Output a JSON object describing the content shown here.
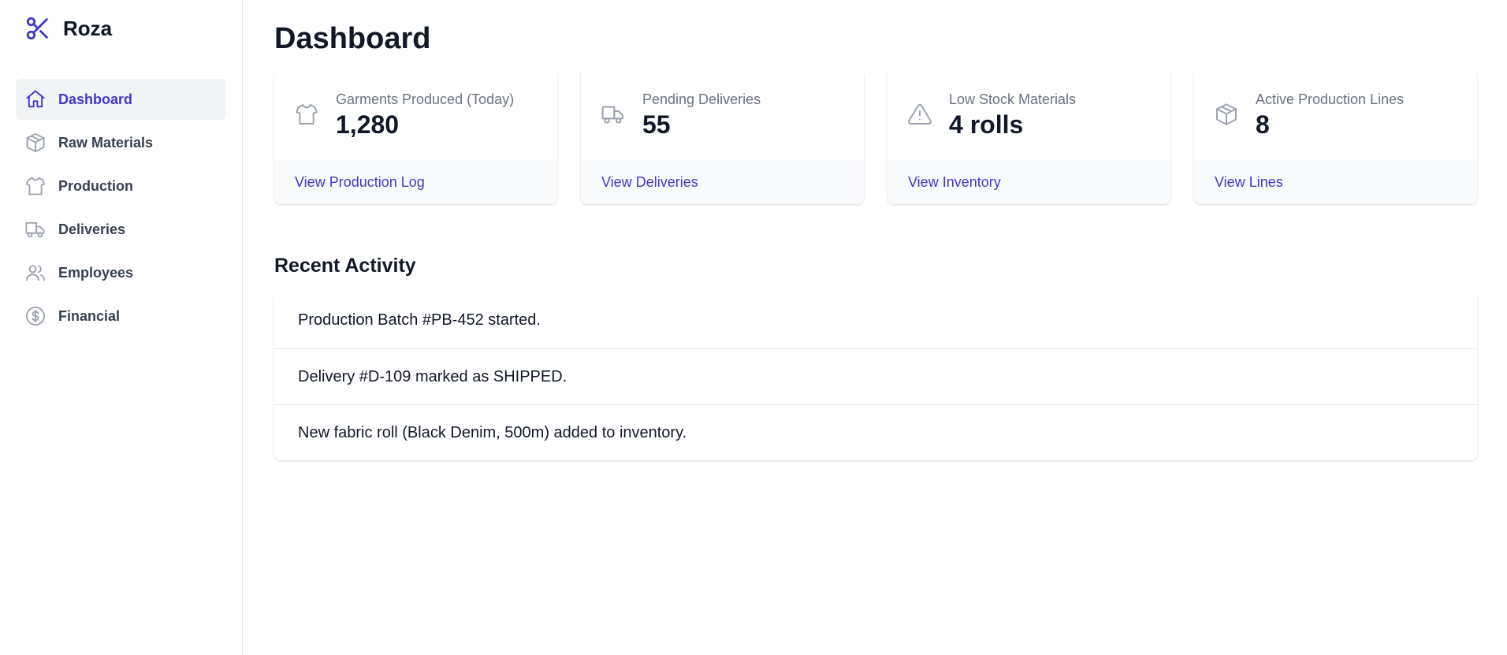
{
  "app": {
    "name": "Roza"
  },
  "sidebar": {
    "items": [
      {
        "label": "Dashboard",
        "icon": "home-icon",
        "active": true
      },
      {
        "label": "Raw Materials",
        "icon": "cube-icon"
      },
      {
        "label": "Production",
        "icon": "shirt-icon"
      },
      {
        "label": "Deliveries",
        "icon": "truck-icon"
      },
      {
        "label": "Employees",
        "icon": "users-icon"
      },
      {
        "label": "Financial",
        "icon": "dollar-circle-icon"
      }
    ]
  },
  "main": {
    "title": "Dashboard",
    "cards": [
      {
        "label": "Garments Produced (Today)",
        "value": "1,280",
        "link": "View Production Log",
        "icon": "shirt-icon"
      },
      {
        "label": "Pending Deliveries",
        "value": "55",
        "link": "View Deliveries",
        "icon": "truck-icon"
      },
      {
        "label": "Low Stock Materials",
        "value": "4 rolls",
        "link": "View Inventory",
        "icon": "warning-icon"
      },
      {
        "label": "Active Production Lines",
        "value": "8",
        "link": "View Lines",
        "icon": "cube-icon"
      }
    ],
    "recent_title": "Recent Activity",
    "activity": [
      "Production Batch #PB-452 started.",
      "Delivery #D-109 marked as SHIPPED.",
      "New fabric roll (Black Denim, 500m) added to inventory."
    ]
  },
  "colors": {
    "accent": "#4338ca",
    "text": "#111827",
    "muted": "#6b7280",
    "nav_text": "#374151",
    "active_bg": "#f3f4f6",
    "card_footer_bg": "#f9fafb",
    "border": "#e5e7eb"
  }
}
